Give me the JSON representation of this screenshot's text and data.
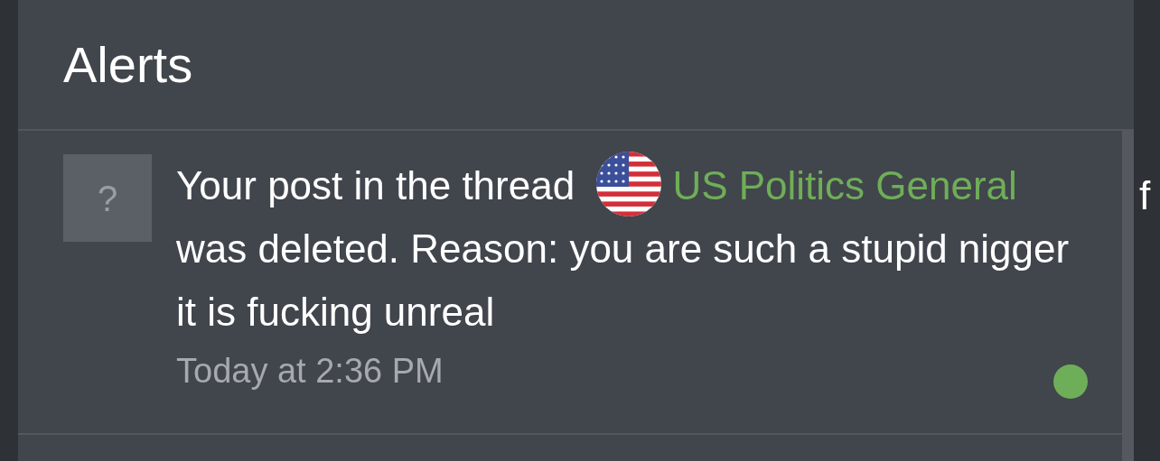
{
  "panel": {
    "title": "Alerts"
  },
  "alerts": [
    {
      "icon": "?",
      "text_before": "Your post in the thread",
      "thread": "US Politics General",
      "text_after": "was deleted. Reason: you are such a stupid nigger it is fucking unreal",
      "time": "Today at 2:36 PM",
      "unread": true
    }
  ],
  "side_text": "f"
}
